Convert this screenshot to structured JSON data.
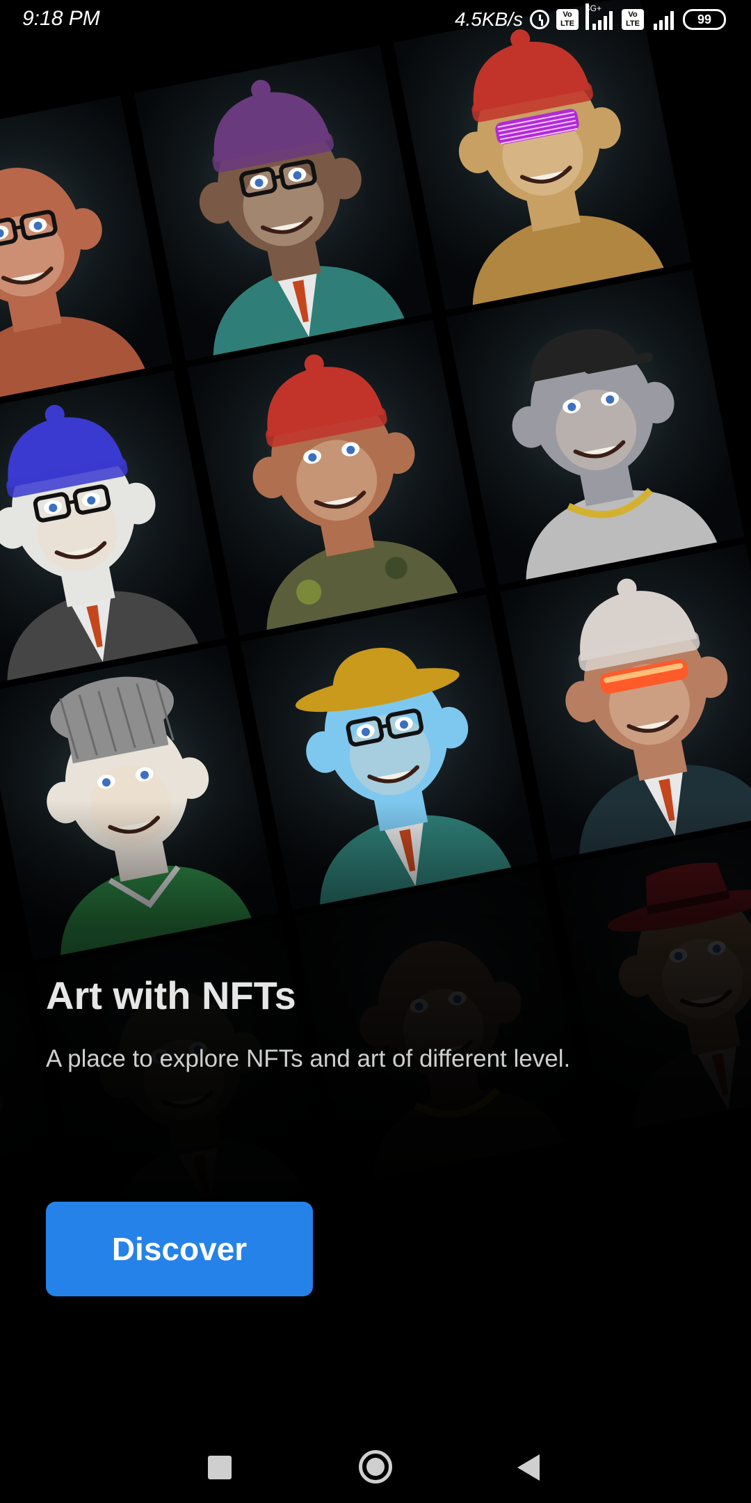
{
  "status_bar": {
    "time": "9:18 PM",
    "net_speed": "4.5KB/s",
    "network_type": "4G+",
    "volte_label": "Vo LTE",
    "battery": "99"
  },
  "onboarding": {
    "title": "Art with NFTs",
    "subtitle": "A place to explore NFTs and art of different level.",
    "discover_label": "Discover"
  },
  "gallery": {
    "apes": [
      {
        "name": "ape-glasses-orange-fur",
        "fur": "#b8674a",
        "hat": "none",
        "hat_color": "",
        "eyewear": "glasses",
        "outfit": "fur",
        "outfit_color": "#a9553a"
      },
      {
        "name": "ape-purple-beanie-suit",
        "fur": "#7a5a46",
        "hat": "beanie",
        "hat_color": "#6a3a7e",
        "eyewear": "glasses",
        "outfit": "suit",
        "outfit_color": "#2f7f78"
      },
      {
        "name": "ape-red-beanie-shades",
        "fur": "#c9a064",
        "hat": "beanie",
        "hat_color": "#c2342a",
        "eyewear": "shutter-shades",
        "outfit": "fur",
        "outfit_color": "#b08640"
      },
      {
        "name": "ape-blue-beanie-banana",
        "fur": "#e5e5e2",
        "hat": "beanie",
        "hat_color": "#3a3ad0",
        "eyewear": "glasses",
        "outfit": "suit",
        "outfit_color": "#454545"
      },
      {
        "name": "ape-red-beanie-wings",
        "fur": "#b0704f",
        "hat": "beanie",
        "hat_color": "#c2342a",
        "eyewear": "none",
        "outfit": "camo",
        "outfit_color": "#5b5e3a"
      },
      {
        "name": "ape-zebra-cap-chain",
        "fur": "#9a9aa2",
        "hat": "cap",
        "hat_color": "#222222",
        "eyewear": "none",
        "outfit": "chain",
        "outfit_color": "#bcbcbc"
      },
      {
        "name": "ape-chef-leopard",
        "fur": "#e8e2d8",
        "hat": "chef",
        "hat_color": "#8e8e8e",
        "eyewear": "none",
        "outfit": "jersey",
        "outfit_color": "#2e8a47"
      },
      {
        "name": "ape-ice-yellow-hat",
        "fur": "#7ec8ef",
        "hat": "bucket",
        "hat_color": "#c99a1c",
        "eyewear": "glasses",
        "outfit": "suit",
        "outfit_color": "#2f7f78"
      },
      {
        "name": "ape-cream-beanie-visor",
        "fur": "#b87e62",
        "hat": "beanie",
        "hat_color": "#d9d2cc",
        "eyewear": "visor",
        "outfit": "suit",
        "outfit_color": "#1f3138"
      },
      {
        "name": "ape-dim-left",
        "fur": "#5a5a4a",
        "hat": "none",
        "hat_color": "",
        "eyewear": "none",
        "outfit": "suit",
        "outfit_color": "#2e5e3a"
      },
      {
        "name": "ape-dim-center",
        "fur": "#6e5244",
        "hat": "none",
        "hat_color": "",
        "eyewear": "none",
        "outfit": "chain",
        "outfit_color": "#4a4038"
      },
      {
        "name": "ape-red-fedora",
        "fur": "#a07a5a",
        "hat": "fedora",
        "hat_color": "#b2222a",
        "eyewear": "none",
        "outfit": "suit",
        "outfit_color": "#2e2e2e"
      },
      {
        "name": "ape-dim-bottom-left",
        "fur": "#7a6a50",
        "hat": "none",
        "hat_color": "",
        "eyewear": "none",
        "outfit": "fur",
        "outfit_color": "#3a3450"
      }
    ]
  },
  "nav": {
    "recents_icon": "square-icon",
    "home_icon": "circle-icon",
    "back_icon": "triangle-icon"
  },
  "colors": {
    "accent": "#2582e8",
    "background": "#000000"
  }
}
